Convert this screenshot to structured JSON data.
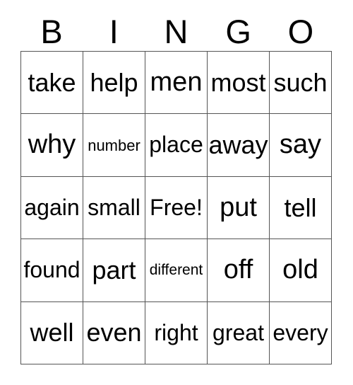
{
  "card": {
    "title": "BINGO",
    "header_letters": [
      "B",
      "I",
      "N",
      "G",
      "O"
    ],
    "free_space_label": "Free!",
    "border_color": "#555555",
    "text_color": "#000000",
    "background_color": "#ffffff",
    "rows": 5,
    "columns": 5,
    "grid": [
      [
        "take",
        "help",
        "men",
        "most",
        "such"
      ],
      [
        "why",
        "number",
        "place",
        "away",
        "say"
      ],
      [
        "again",
        "small",
        "Free!",
        "put",
        "tell"
      ],
      [
        "found",
        "part",
        "different",
        "off",
        "old"
      ],
      [
        "well",
        "even",
        "right",
        "great",
        "every"
      ]
    ]
  }
}
